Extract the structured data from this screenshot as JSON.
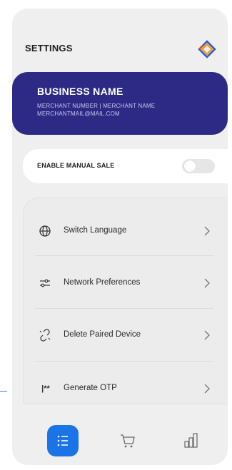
{
  "header": {
    "title": "SETTINGS",
    "logo_icon": "diamond-logo-icon"
  },
  "business": {
    "name": "BUSINESS NAME",
    "merchant_line": "MERCHANT NUMBER | MERCHANT NAME",
    "email": "MERCHANTMAIL@MAIL.COM"
  },
  "manual_sale": {
    "label": "ENABLE MANUAL SALE",
    "enabled": false
  },
  "menu": {
    "items": [
      {
        "label": "Switch Language",
        "icon": "globe-icon",
        "glyph": "⊕"
      },
      {
        "label": "Network Preferences",
        "icon": "sliders-icon",
        "glyph": ""
      },
      {
        "label": "Delete Paired Device",
        "icon": "broken-link-icon",
        "glyph": ""
      },
      {
        "label": "Generate OTP",
        "icon": "password-icon",
        "glyph": "|**"
      }
    ]
  },
  "bottom_nav": {
    "items": [
      {
        "icon": "list-icon",
        "active": true
      },
      {
        "icon": "cart-icon",
        "active": false
      },
      {
        "icon": "bar-chart-icon",
        "active": false
      }
    ]
  },
  "colors": {
    "primary": "#2d2a86",
    "accent": "#1b73e8",
    "background": "#efefef"
  }
}
